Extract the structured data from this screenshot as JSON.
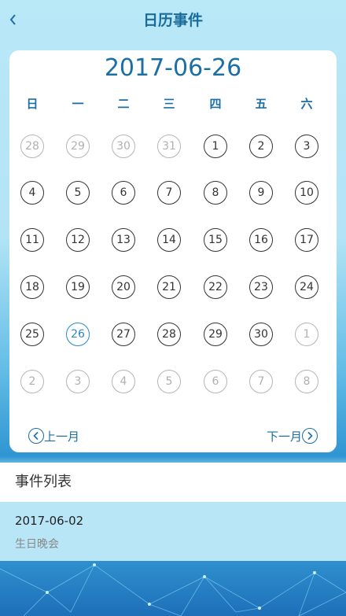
{
  "header": {
    "title": "日历事件",
    "back_icon": "chevron-left-icon"
  },
  "calendar": {
    "selected_date": "2017-06-26",
    "weekdays": [
      "日",
      "一",
      "二",
      "三",
      "四",
      "五",
      "六"
    ],
    "weeks": [
      [
        {
          "d": "28",
          "o": true
        },
        {
          "d": "29",
          "o": true
        },
        {
          "d": "30",
          "o": true
        },
        {
          "d": "31",
          "o": true
        },
        {
          "d": "1"
        },
        {
          "d": "2"
        },
        {
          "d": "3"
        }
      ],
      [
        {
          "d": "4"
        },
        {
          "d": "5"
        },
        {
          "d": "6"
        },
        {
          "d": "7"
        },
        {
          "d": "8"
        },
        {
          "d": "9"
        },
        {
          "d": "10"
        }
      ],
      [
        {
          "d": "11"
        },
        {
          "d": "12"
        },
        {
          "d": "13"
        },
        {
          "d": "14"
        },
        {
          "d": "15"
        },
        {
          "d": "16"
        },
        {
          "d": "17"
        }
      ],
      [
        {
          "d": "18"
        },
        {
          "d": "19"
        },
        {
          "d": "20"
        },
        {
          "d": "21"
        },
        {
          "d": "22"
        },
        {
          "d": "23"
        },
        {
          "d": "24"
        }
      ],
      [
        {
          "d": "25"
        },
        {
          "d": "26",
          "s": true
        },
        {
          "d": "27"
        },
        {
          "d": "28"
        },
        {
          "d": "29"
        },
        {
          "d": "30"
        },
        {
          "d": "1",
          "o": true
        }
      ],
      [
        {
          "d": "2",
          "o": true
        },
        {
          "d": "3",
          "o": true
        },
        {
          "d": "4",
          "o": true
        },
        {
          "d": "5",
          "o": true
        },
        {
          "d": "6",
          "o": true
        },
        {
          "d": "7",
          "o": true
        },
        {
          "d": "8",
          "o": true
        }
      ]
    ],
    "prev_label": "上一月",
    "next_label": "下一月",
    "prev_icon": "circle-chevron-left-icon",
    "next_icon": "circle-chevron-right-icon"
  },
  "events": {
    "header": "事件列表",
    "items": [
      {
        "date": "2017-06-02",
        "name": "生日晚会"
      }
    ]
  },
  "colors": {
    "accent": "#1c6fa3",
    "selected": "#2a88c4",
    "background": "#b9e8f7"
  }
}
